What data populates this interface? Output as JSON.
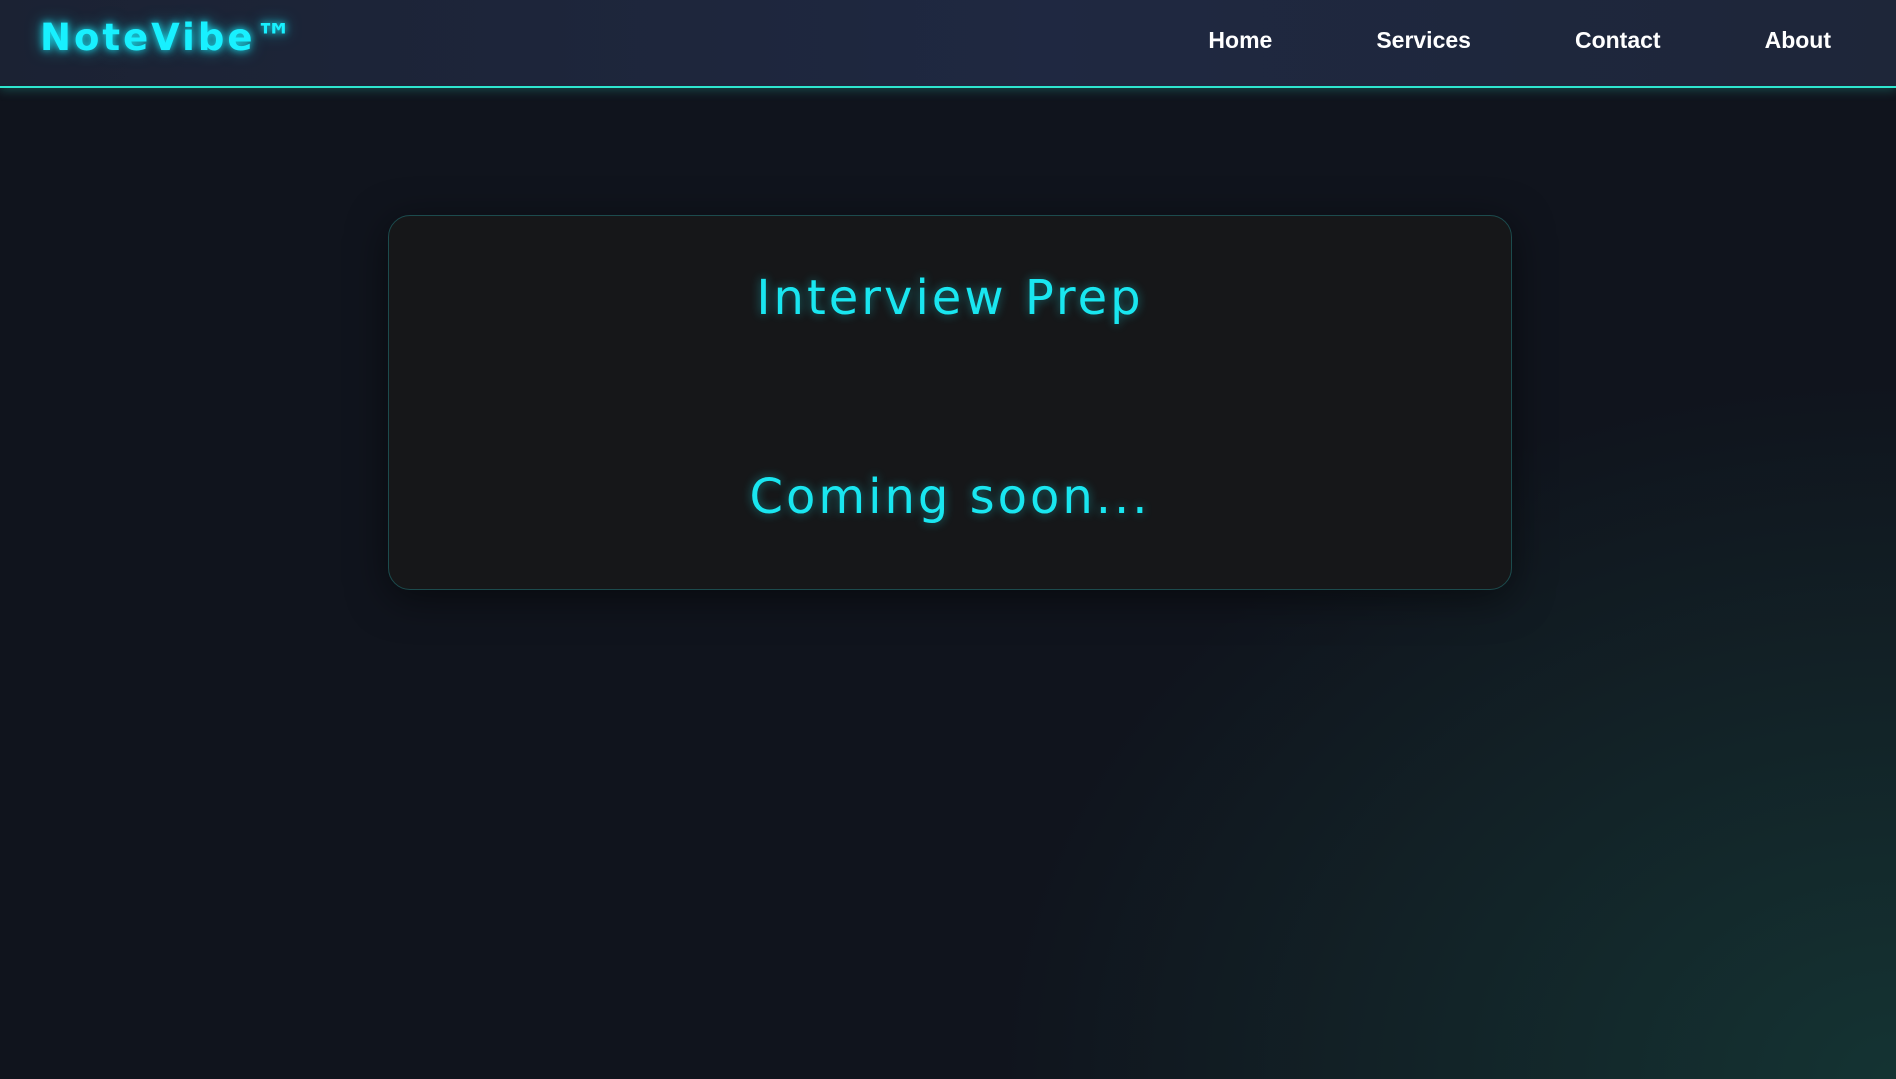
{
  "brand": {
    "logo_text": "NoteVibe™"
  },
  "nav": {
    "items": [
      {
        "label": "Home"
      },
      {
        "label": "Services"
      },
      {
        "label": "Contact"
      },
      {
        "label": "About"
      }
    ]
  },
  "main": {
    "card_title": "Interview Prep",
    "card_status": "Coming soon..."
  },
  "colors": {
    "accent": "#19e6f0",
    "nav_border": "#2ee6cf",
    "background": "#10141d",
    "card_background": "#161719",
    "nav_text": "#ffffff"
  }
}
